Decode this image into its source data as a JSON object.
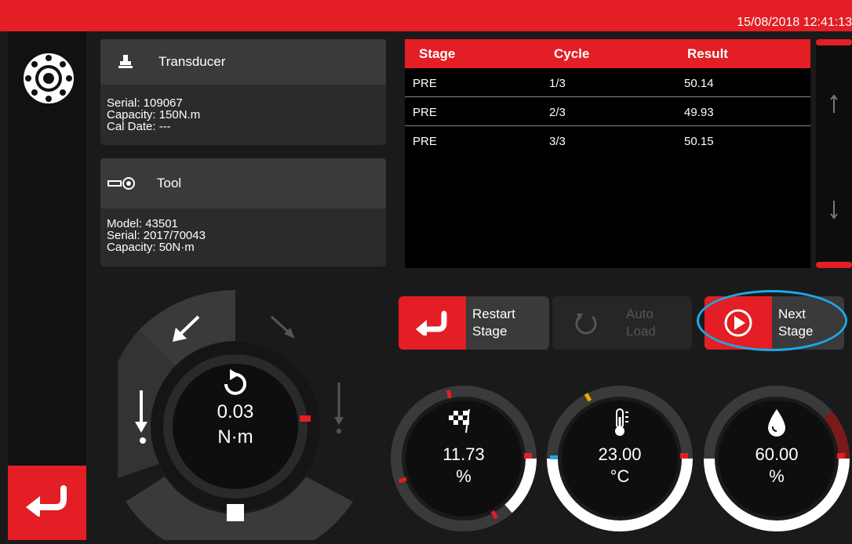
{
  "header": {
    "datetime": "15/08/2018 12:41:13"
  },
  "transducer": {
    "title": "Transducer",
    "serial": "Serial: 109067",
    "capacity": "Capacity: 150N.m",
    "cal_date": "Cal Date: ---"
  },
  "tool": {
    "title": "Tool",
    "model": "Model: 43501",
    "serial": "Serial: 2017/70043",
    "capacity": "Capacity: 50N·m"
  },
  "results_table": {
    "headers": [
      "Stage",
      "Cycle",
      "Result"
    ],
    "rows": [
      [
        "PRE",
        "1/3",
        "50.14"
      ],
      [
        "PRE",
        "2/3",
        "49.93"
      ],
      [
        "PRE",
        "3/3",
        "50.15"
      ]
    ]
  },
  "buttons": {
    "restart_line1": "Restart",
    "restart_line2": "Stage",
    "autoload_line1": "Auto",
    "autoload_line2": "Load",
    "next_line1": "Next",
    "next_line2": "Stage"
  },
  "torque_dial": {
    "value": "0.03",
    "unit": "N·m"
  },
  "gauges": [
    {
      "name": "progress",
      "value": "11.73",
      "unit": "%",
      "icon": "checkered-flag-icon"
    },
    {
      "name": "temperature",
      "value": "23.00",
      "unit": "°C",
      "icon": "thermometer-icon"
    },
    {
      "name": "humidity",
      "value": "60.00",
      "unit": "%",
      "icon": "water-drop-icon"
    }
  ],
  "colors": {
    "accent": "#e31e24",
    "highlight": "#1ea7e8",
    "warning": "#f0a500"
  }
}
